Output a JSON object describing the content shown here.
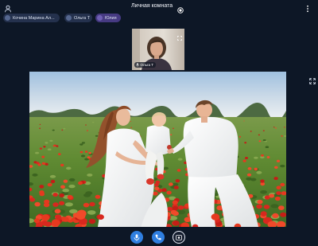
{
  "room": {
    "title": "Личная комната"
  },
  "participants": [
    {
      "name": "Кочина Марина Ал...",
      "color": "#24314d"
    },
    {
      "name": "Ольга Т",
      "color": "#24314d"
    },
    {
      "name": "Юлия",
      "color": "#463a82"
    }
  ],
  "self_video": {
    "name": "Ольга Т"
  },
  "icons": {
    "profile": "person-icon",
    "record": "record-icon",
    "menu": "more-vertical-icon",
    "thumb_fullscreen": "fullscreen-icon",
    "stage_expand": "expand-icon",
    "mic": "microphone-icon",
    "call": "phone-icon",
    "camera": "camera-icon"
  },
  "colors": {
    "background": "#0d1726",
    "accent": "#2f7fe0",
    "chip": "#24314d",
    "chip_highlight": "#463a82"
  }
}
